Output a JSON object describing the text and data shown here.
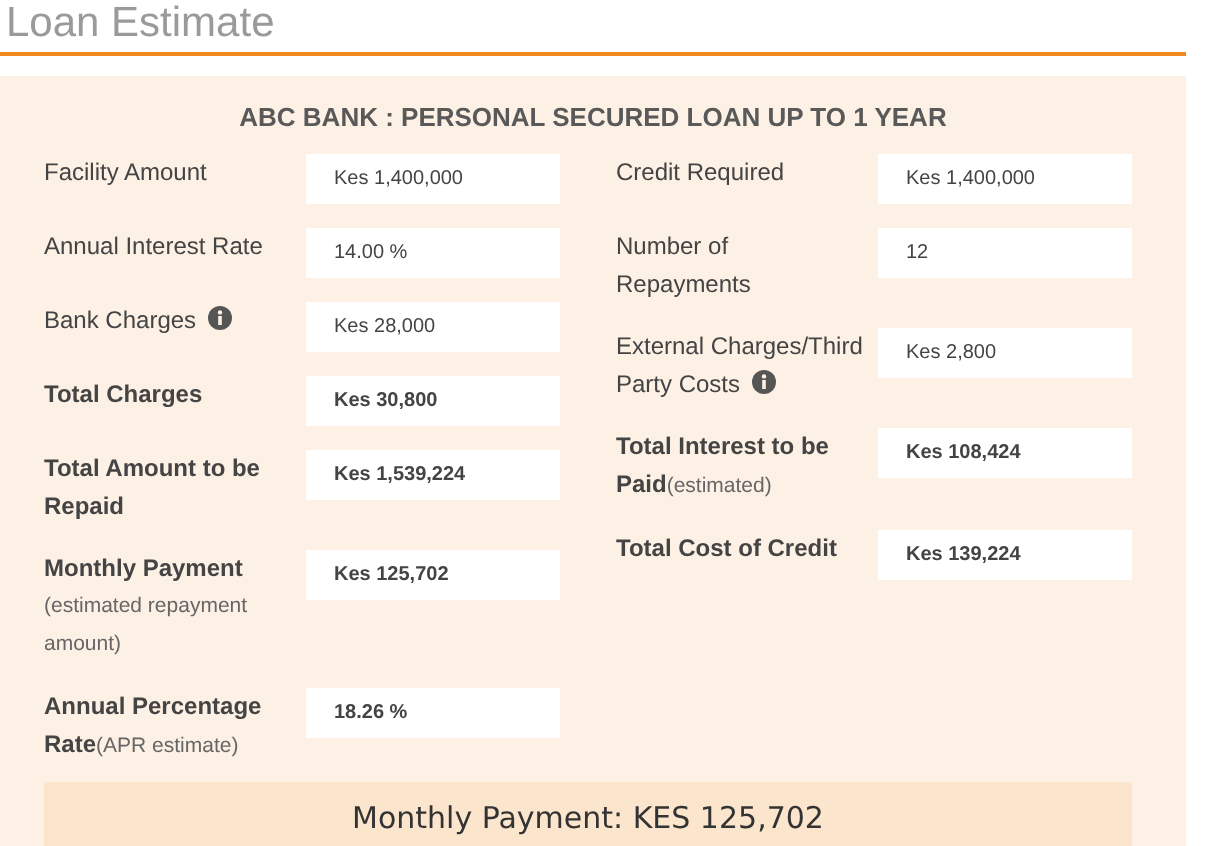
{
  "title": "Loan Estimate",
  "heading": "ABC BANK : PERSONAL SECURED LOAN UP TO 1 YEAR",
  "columns": [
    [
      {
        "label": "Facility Amount",
        "value": "Kes 1,400,000",
        "bold": false,
        "info": false
      },
      {
        "label": "Annual Interest Rate",
        "value": "14.00 %",
        "bold": false,
        "info": false
      },
      {
        "label": "Bank Charges",
        "value": "Kes 28,000",
        "bold": false,
        "info": true
      },
      {
        "label": "Total Charges",
        "value": "Kes 30,800",
        "bold": true,
        "info": false
      },
      {
        "label": "Total Amount to be Repaid",
        "value": "Kes 1,539,224",
        "bold": true,
        "info": false
      },
      {
        "label": "Monthly Payment",
        "note": "(estimated repayment amount)",
        "note_block": true,
        "value": "Kes 125,702",
        "bold": true,
        "info": false
      },
      {
        "label": "Annual Percentage Rate",
        "note": "(APR estimate)",
        "note_block": false,
        "value": "18.26 %",
        "bold": true,
        "info": false
      }
    ],
    [
      {
        "label": "Credit Required",
        "value": "Kes 1,400,000",
        "bold": false,
        "info": false
      },
      {
        "label": "Number of Repayments",
        "value": "12",
        "bold": false,
        "info": false
      },
      {
        "label": "External Charges/Third Party Costs",
        "value": "Kes 2,800",
        "bold": false,
        "info": true
      },
      {
        "label": "Total Interest to be Paid",
        "note": "(estimated)",
        "note_block": false,
        "value": "Kes 108,424",
        "bold": true,
        "info": false
      },
      {
        "label": "Total Cost of Credit",
        "value": "Kes 139,224",
        "bold": true,
        "info": false
      }
    ]
  ],
  "summary": "Monthly Payment: KES 125,702"
}
